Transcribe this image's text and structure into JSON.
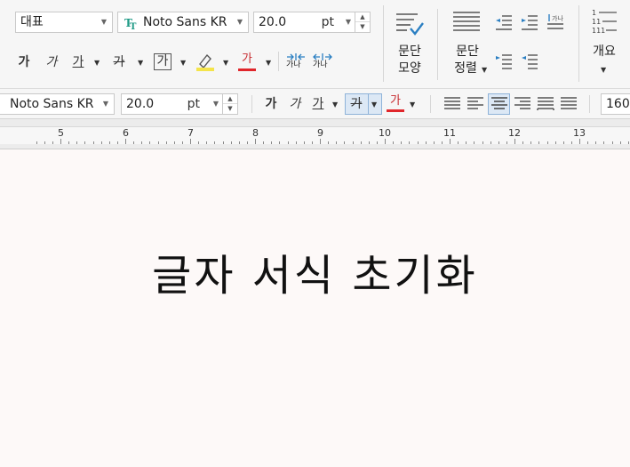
{
  "ribbon": {
    "style_combo": {
      "value": "대표"
    },
    "font_combo": {
      "value": "Noto Sans KR",
      "icon": "truetype-font-icon"
    },
    "size_combo": {
      "value": "20.0",
      "unit": "pt"
    },
    "char_buttons": {
      "bold": "가",
      "italic": "가",
      "underline": "가",
      "strike": "가",
      "box": "가",
      "color": "가",
      "narrow": "가나",
      "wide": "가나"
    },
    "paragraph_shape": {
      "line1": "문단",
      "line2": "모양"
    },
    "paragraph_align": {
      "line1": "문단",
      "line2": "정렬"
    },
    "outline": {
      "label": "개요"
    }
  },
  "formatbar": {
    "font_combo": {
      "value": "Noto Sans KR"
    },
    "size_combo": {
      "value": "20.0",
      "unit": "pt"
    },
    "char_buttons": {
      "bold": "가",
      "italic": "가",
      "underline": "가",
      "strike": "가",
      "color": "가"
    },
    "zoom": {
      "value": "160"
    }
  },
  "ruler": {
    "labels": [
      "5",
      "6",
      "7",
      "8",
      "9",
      "10",
      "11",
      "12",
      "13"
    ]
  },
  "document": {
    "text": "글자 서식 초기화"
  },
  "colors": {
    "highlight": "#f4e44a",
    "font_color": "#e0262b",
    "accent": "#2b7fc2"
  }
}
